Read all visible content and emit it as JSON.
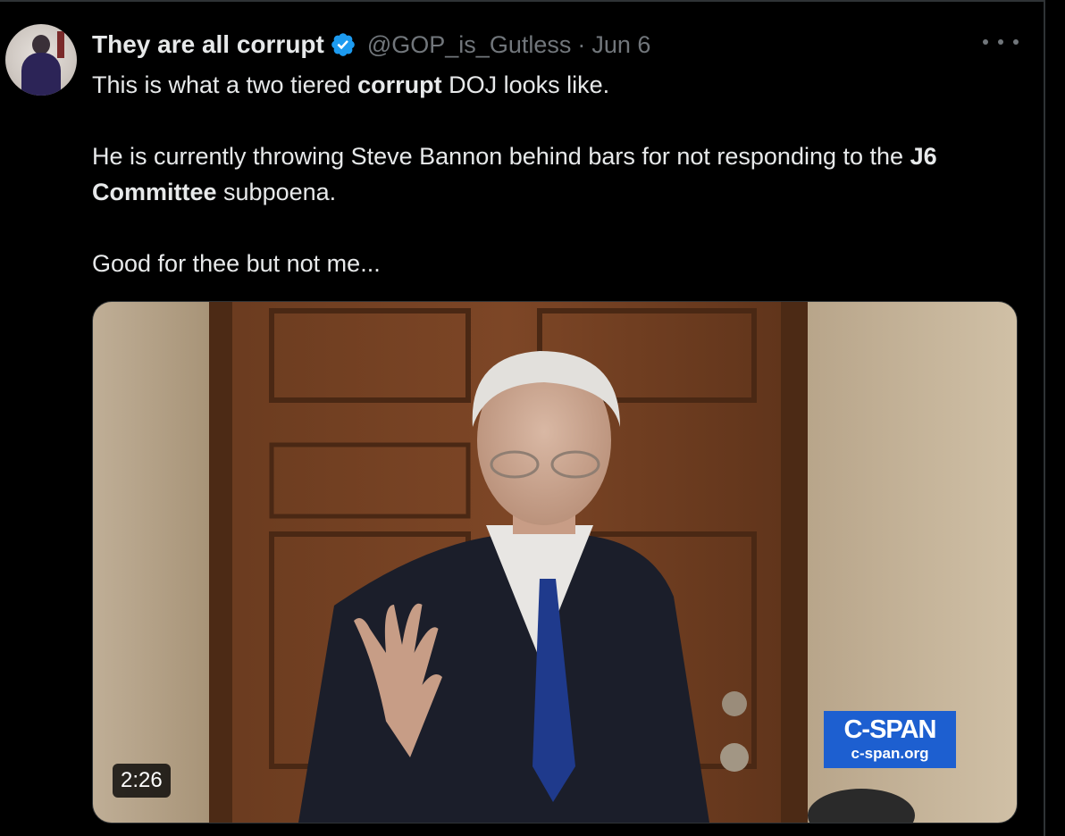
{
  "tweet": {
    "author_name": "They are all corrupt",
    "handle": "@GOP_is_Gutless",
    "separator": "·",
    "date": "Jun 6",
    "text": {
      "line1_pre": "This is what a two tiered ",
      "line1_bold": "corrupt",
      "line1_post": " DOJ looks like.",
      "para2_pre": "He is currently throwing Steve Bannon behind bars for not responding to the ",
      "para2_bold": "J6 Committee",
      "para2_post": " subpoena.",
      "para3": "Good for thee but not me..."
    },
    "video": {
      "duration": "2:26",
      "watermark_line1": "C-SPAN",
      "watermark_line2": "c-span.org"
    }
  },
  "icons": {
    "verified": "verified-badge-icon",
    "more": "more-options-icon"
  },
  "colors": {
    "background": "#000000",
    "text_primary": "#e7e9ea",
    "text_secondary": "#71767b",
    "verified_blue": "#1d9bf0",
    "cspan_blue": "#1d5fd0"
  }
}
